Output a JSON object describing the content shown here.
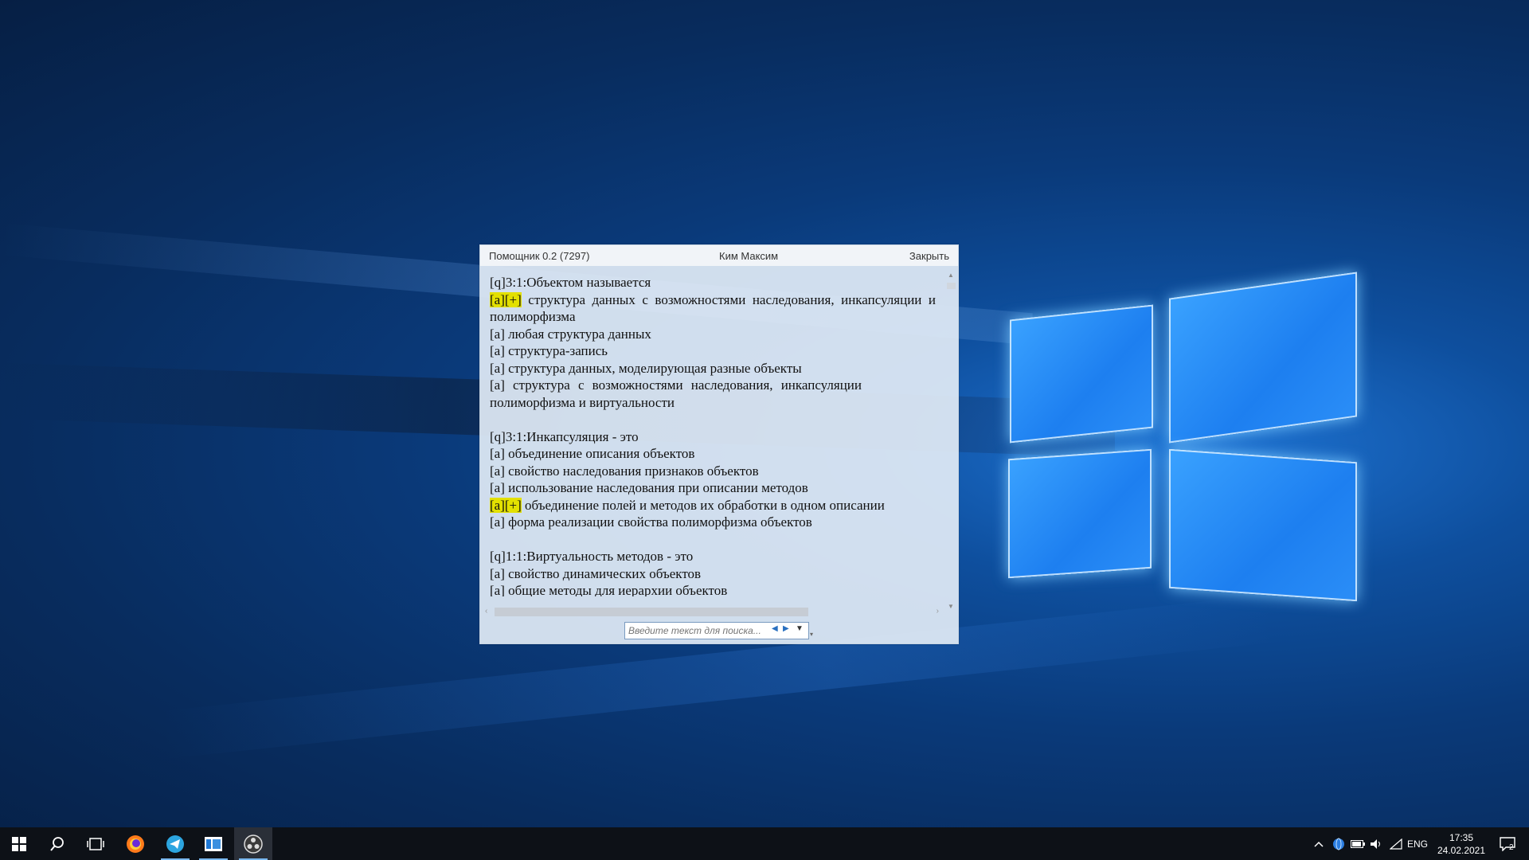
{
  "window": {
    "title": "Помощник 0.2 (7297)",
    "user": "Ким Максим",
    "close_label": "Закрыть"
  },
  "content": {
    "q1": {
      "question": "[q]3:1:Объектом называется",
      "correct_marker": "[a][+]",
      "a1": " структура данных с возможностями наследования, инкапсуляции и полиморфизма",
      "a2": "[a] любая структура данных",
      "a3": "[a] структура-запись",
      "a4": "[a] структура данных, моделирующая разные объекты",
      "a5": "[a] структура с возможностями наследования, инкапсуляции полиморфизма и виртуальности"
    },
    "q2": {
      "question": "[q]3:1:Инкапсуляция - это",
      "a1": "[a] объединение описания объектов",
      "a2": "[a] свойство наследования признаков объектов",
      "a3": "[a] использование наследования при описании методов",
      "correct_marker": "[a][+]",
      "a4": " объединение полей и методов их обработки в одном описании",
      "a5": "[a] форма реализации свойства полиморфизма объектов"
    },
    "q3": {
      "question": "[q]1:1:Виртуальность методов - это",
      "a1": "[a] свойство динамических объектов",
      "a2": "[a] общие методы для иерархии объектов"
    }
  },
  "search": {
    "placeholder": "Введите текст для поиска..."
  },
  "taskbar": {
    "items": [
      "start-icon",
      "search-icon",
      "task-view-icon",
      "firefox-icon",
      "telegram-icon",
      "app-window-icon",
      "obs-icon"
    ]
  },
  "tray": {
    "language": "ENG",
    "time": "17:35",
    "date": "24.02.2021",
    "notifications": "2"
  },
  "colors": {
    "highlight": "#e3e000",
    "taskbar": "#0d1117",
    "accent": "#79b8f0"
  }
}
